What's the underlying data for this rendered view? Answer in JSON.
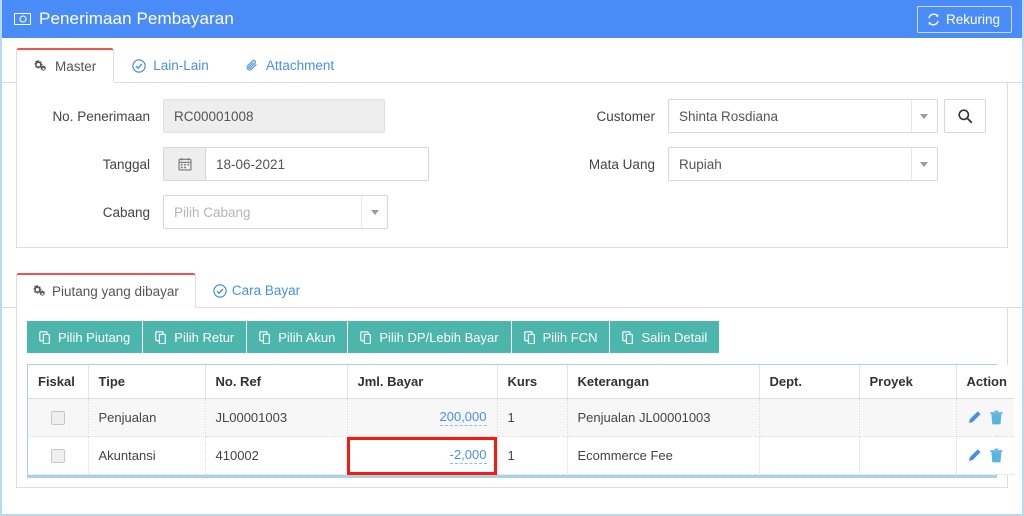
{
  "titlebar": {
    "icon": "money-icon",
    "title": "Penerimaan Pembayaran",
    "rekuring_label": "Rekuring",
    "rekuring_icon": "sync-icon",
    "bg_color": "#4a8cf7"
  },
  "top_tabs": [
    {
      "label": "Master",
      "icon": "gears-icon",
      "active": true
    },
    {
      "label": "Lain-Lain",
      "icon": "check-circle-icon",
      "active": false
    },
    {
      "label": "Attachment",
      "icon": "paperclip-icon",
      "active": false
    }
  ],
  "form": {
    "no_penerimaan": {
      "label": "No. Penerimaan",
      "value": "RC00001008",
      "readonly": true
    },
    "tanggal": {
      "label": "Tanggal",
      "value": "18-06-2021",
      "icon": "calendar-icon"
    },
    "cabang": {
      "label": "Cabang",
      "value": "",
      "placeholder": "Pilih Cabang",
      "icon": "chevron-down-icon"
    },
    "customer": {
      "label": "Customer",
      "value": "Shinta Rosdiana",
      "icon": "chevron-down-icon",
      "search_icon": "search-icon"
    },
    "mata_uang": {
      "label": "Mata Uang",
      "value": "Rupiah",
      "icon": "chevron-down-icon"
    }
  },
  "lower_tabs": [
    {
      "label": "Piutang yang dibayar",
      "icon": "gears-icon",
      "active": true
    },
    {
      "label": "Cara Bayar",
      "icon": "check-circle-icon",
      "active": false
    }
  ],
  "action_buttons": [
    {
      "label": "Pilih Piutang",
      "icon": "copy-icon"
    },
    {
      "label": "Pilih Retur",
      "icon": "copy-icon"
    },
    {
      "label": "Pilih Akun",
      "icon": "copy-icon"
    },
    {
      "label": "Pilih DP/Lebih Bayar",
      "icon": "copy-icon"
    },
    {
      "label": "Pilih FCN",
      "icon": "copy-icon"
    },
    {
      "label": "Salin Detail",
      "icon": "copy-icon"
    }
  ],
  "button_color": "#4db6ac",
  "table": {
    "columns": [
      "Fiskal",
      "Tipe",
      "No. Ref",
      "Jml. Bayar",
      "Kurs",
      "Keterangan",
      "Dept.",
      "Proyek",
      "Action"
    ],
    "rows": [
      {
        "fiskal": "",
        "tipe": "Penjualan",
        "no_ref": "JL00001003",
        "jml_bayar": "200,000",
        "kurs": "1",
        "keterangan": "Penjualan JL00001003",
        "dept": "",
        "proyek": "",
        "highlighted": false
      },
      {
        "fiskal": "",
        "tipe": "Akuntansi",
        "no_ref": "410002",
        "jml_bayar": "-2,000",
        "kurs": "1",
        "keterangan": "Ecommerce Fee",
        "dept": "",
        "proyek": "",
        "highlighted": true
      }
    ],
    "row_actions": [
      {
        "icon": "pencil-icon"
      },
      {
        "icon": "trash-icon"
      }
    ],
    "highlight_color": "#f51a12",
    "link_color": "#4a90e2"
  }
}
